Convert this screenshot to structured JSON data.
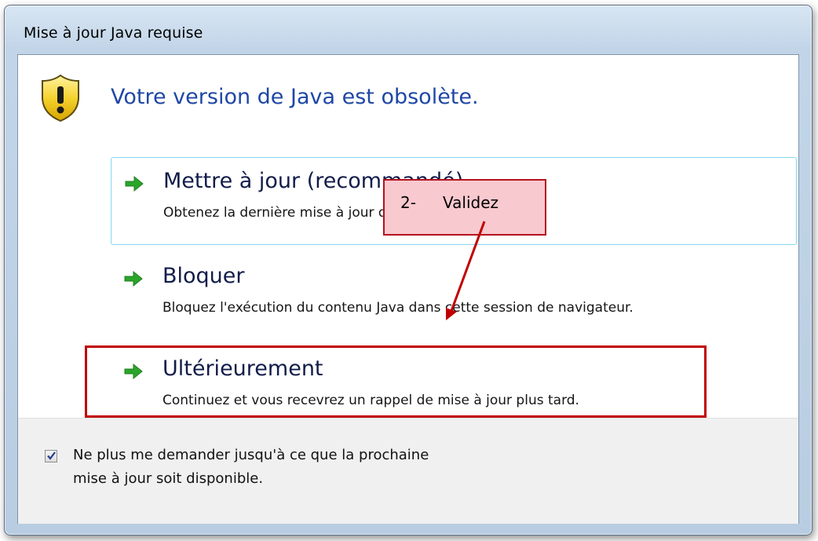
{
  "window": {
    "title": "Mise à jour Java requise"
  },
  "header": {
    "icon": "warning-shield-icon",
    "headline": "Votre version de Java est obsolète."
  },
  "options": [
    {
      "icon": "green-arrow-icon",
      "title": "Mettre à jour (recommandé)",
      "description": "Obtenez la dernière mise à jour de sécurité sur java.com."
    },
    {
      "icon": "green-arrow-icon",
      "title": "Bloquer",
      "description": "Bloquez l'exécution du contenu Java dans cette session de navigateur."
    },
    {
      "icon": "green-arrow-icon",
      "title": "Ultérieurement",
      "description": "Continuez et vous recevrez un rappel de mise à jour plus tard."
    }
  ],
  "footer": {
    "checkbox_checked": true,
    "checkbox_label_line1": "Ne plus me demander jusqu'à ce que la prochaine",
    "checkbox_label_line2": "mise à jour soit disponible."
  },
  "annotation": {
    "step_number": "2-",
    "step_text": "Validez",
    "frame_color": "#c00000",
    "callout_fill": "#f8c9cf"
  },
  "colors": {
    "headline": "#1f47a6",
    "arrow_green": "#2aa52a",
    "highlight_border": "#8ed9ee"
  }
}
